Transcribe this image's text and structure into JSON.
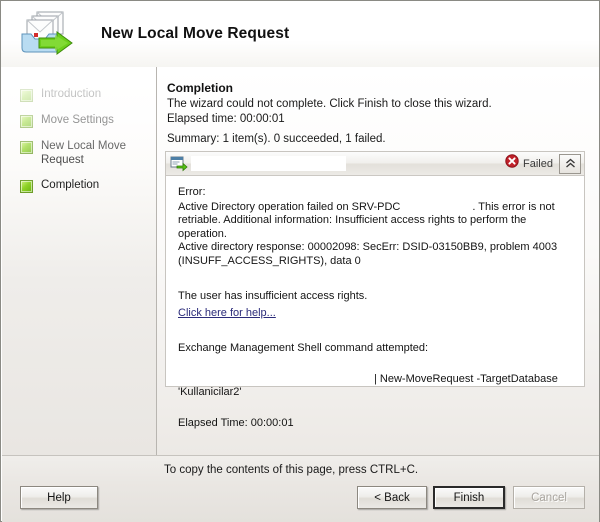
{
  "window": {
    "title": "New Local Move Request",
    "app_icon": "mailbox-move-icon"
  },
  "sidebar": {
    "items": [
      {
        "label": "Introduction",
        "bullet": "step-complete-icon"
      },
      {
        "label": "Move Settings",
        "bullet": "step-complete-icon"
      },
      {
        "label": "New Local Move Request",
        "bullet": "step-complete-icon"
      },
      {
        "label": "Completion",
        "bullet": "step-complete-icon"
      }
    ]
  },
  "main": {
    "heading": "Completion",
    "status_line": "The wizard could not complete. Click Finish to close this wizard.",
    "elapsed_line": "Elapsed time: 00:00:01",
    "summary_line": "Summary: 1 item(s). 0 succeeded, 1 failed."
  },
  "result": {
    "header": {
      "icon": "mailbox-move-small-icon",
      "name_value": "",
      "status_icon": "error-x-icon",
      "status_text": "Failed",
      "collapse_icon": "chevron-double-up-icon"
    },
    "error_label": "Error:",
    "error_text_before": "Active Directory operation failed on SRV-PDC",
    "error_text_after": ". This error is not retriable. Additional information: Insufficient access rights to perform the operation.",
    "ad_response": "Active directory response: 00002098: SecErr: DSID-03150BB9, problem 4003 (INSUFF_ACCESS_RIGHTS), data 0",
    "user_rights_note": "The user has insufficient access rights.",
    "help_link": "Click here for help...",
    "shell_label": "Exchange Management Shell command attempted:",
    "shell_command": "| New-MoveRequest -TargetDatabase 'Kullanicilar2'",
    "elapsed_time": "Elapsed Time: 00:00:01"
  },
  "footer": {
    "copy_hint": "To copy the contents of this page, press CTRL+C.",
    "help_label": "Help",
    "back_label": "< Back",
    "finish_label": "Finish",
    "cancel_label": "Cancel"
  },
  "colors": {
    "error_red": "#c0212a",
    "step_green": "#8fd227",
    "link_blue": "#2b2b7a",
    "arrow_green": "#5cc016"
  }
}
